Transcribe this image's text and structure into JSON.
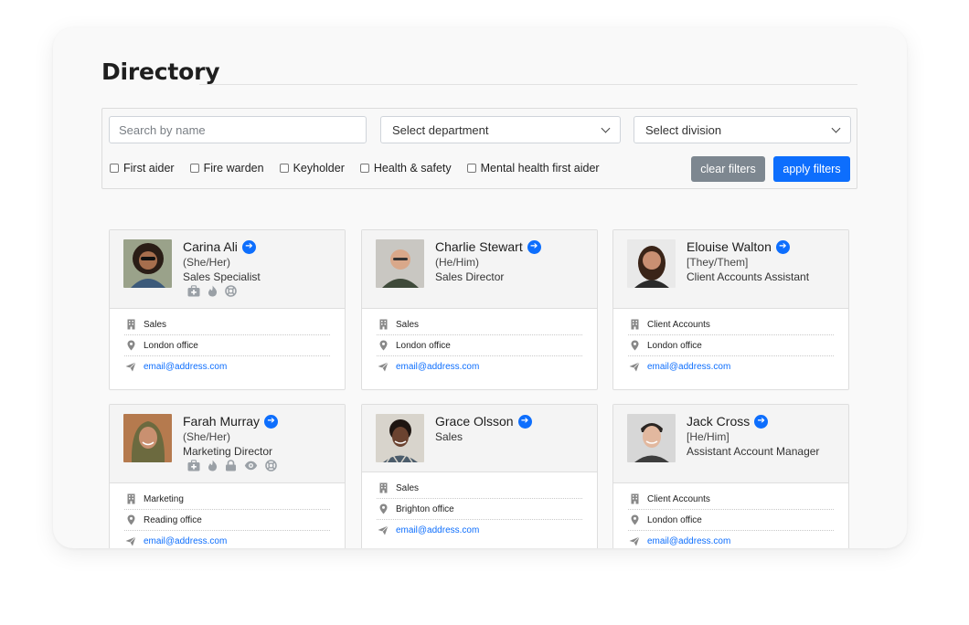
{
  "page": {
    "title": "Directory"
  },
  "filters": {
    "search_placeholder": "Search by name",
    "department_select": "Select department",
    "division_select": "Select division",
    "checkboxes": [
      "First aider",
      "Fire warden",
      "Keyholder",
      "Health & safety",
      "Mental health first aider"
    ],
    "clear_label": "clear filters",
    "apply_label": "apply filters"
  },
  "colors": {
    "accent": "#0d6efd",
    "secondary": "#7d8790"
  },
  "people": [
    {
      "name": "Carina Ali",
      "pronouns": "(She/Her)",
      "role": "Sales Specialist",
      "badges": [
        "first-aid-icon",
        "fire-icon",
        "lifebuoy-icon"
      ],
      "department": "Sales",
      "office": "London office",
      "email": "email@address.com"
    },
    {
      "name": "Charlie Stewart",
      "pronouns": "(He/Him)",
      "role": "Sales Director",
      "badges": [],
      "department": "Sales",
      "office": "London office",
      "email": "email@address.com"
    },
    {
      "name": "Elouise Walton",
      "pronouns": "[They/Them]",
      "role": "Client Accounts Assistant",
      "badges": [],
      "department": "Client Accounts",
      "office": "London office",
      "email": "email@address.com"
    },
    {
      "name": "Farah Murray",
      "pronouns": "(She/Her)",
      "role": "Marketing Director",
      "badges": [
        "first-aid-icon",
        "fire-icon",
        "lock-icon",
        "eye-icon",
        "lifebuoy-icon"
      ],
      "department": "Marketing",
      "office": "Reading office",
      "email": "email@address.com"
    },
    {
      "name": "Grace Olsson",
      "pronouns": "",
      "role": "Sales",
      "badges": [],
      "department": "Sales",
      "office": "Brighton office",
      "email": "email@address.com"
    },
    {
      "name": "Jack Cross",
      "pronouns": "[He/Him]",
      "role": "Assistant Account Manager",
      "badges": [],
      "department": "Client Accounts",
      "office": "London office",
      "email": "email@address.com"
    }
  ]
}
